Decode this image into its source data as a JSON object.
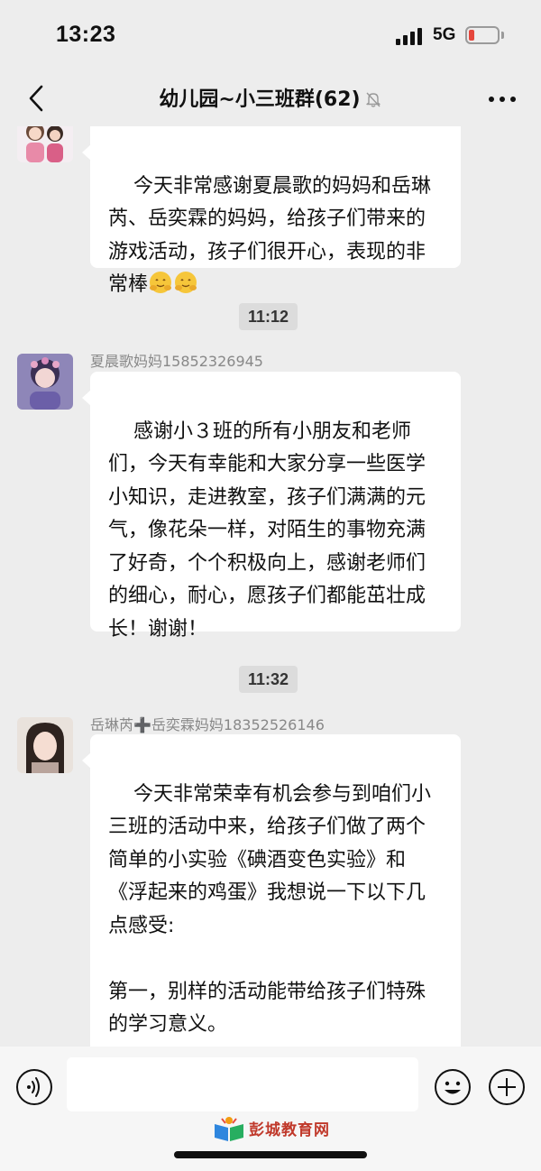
{
  "status_bar": {
    "time": "13:23",
    "network": "5G",
    "battery_level": 0.2,
    "battery_color": "#e5463c"
  },
  "nav": {
    "title": "幼儿园~小三班群(62)",
    "back_icon": "chevron-left-icon",
    "mute_icon": "bell-muted-icon",
    "more_icon": "more-dots-icon"
  },
  "messages": [
    {
      "sender": "",
      "text": "今天非常感谢夏晨歌的妈妈和岳琳芮、岳奕霖的妈妈，给孩子们带来的游戏活动，孩子们很开心，表现的非常棒",
      "emoji": [
        "hug-face-emoji",
        "hug-face-emoji"
      ]
    },
    {
      "time": "11:12",
      "sender": "夏晨歌妈妈15852326945",
      "text": "感谢小３班的所有小朋友和老师们，今天有幸能和大家分享一些医学小知识，走进教室，孩子们满满的元气，像花朵一样，对陌生的事物充满了好奇，个个积极向上，感谢老师们的细心，耐心，愿孩子们都能茁壮成长！谢谢！"
    },
    {
      "time": "11:32",
      "sender": "岳琳芮➕岳奕霖妈妈18352526146",
      "text": "今天非常荣幸有机会参与到咱们小三班的活动中来，给孩子们做了两个简单的小实验《碘酒变色实验》和《浮起来的鸡蛋》我想说一下以下几点感受:\n\n第一，别样的活动能带给孩子们特殊的学习意义。\n孩子们都是天真活泼，对生活万物充满好奇的，从每个孩子的眼神和笑脸当中我能看出来，"
    }
  ],
  "input_bar": {
    "voice_icon": "voice-icon",
    "text_value": "",
    "emoji_icon": "emoji-icon",
    "plus_icon": "plus-icon"
  },
  "watermark": {
    "text": "彭城教育网"
  },
  "colors": {
    "background": "#ededed",
    "bubble": "#ffffff",
    "time_chip": "#dcdcdc"
  }
}
